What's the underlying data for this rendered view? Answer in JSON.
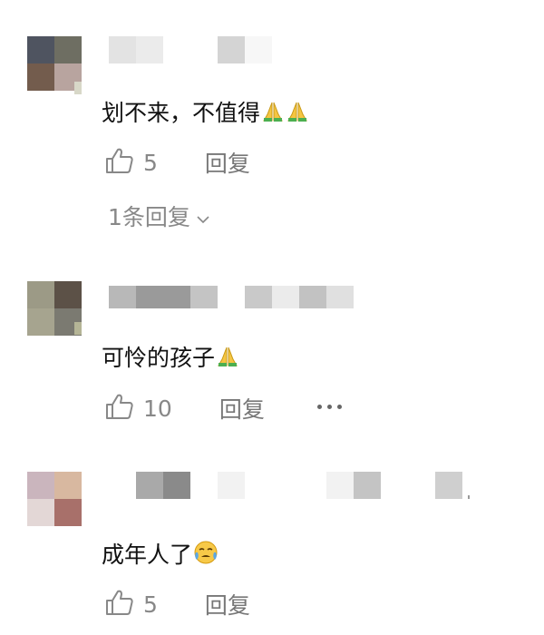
{
  "colors": {
    "text": "#111111",
    "muted": "#888888",
    "reply": "#777777"
  },
  "comments": [
    {
      "text": "划不来，不值得",
      "emoji": [
        "folded-hands",
        "folded-hands"
      ],
      "likes": "5",
      "reply_label": "回复",
      "sub_replies_label": "1条回复"
    },
    {
      "text": "可怜的孩子",
      "emoji": [
        "folded-hands"
      ],
      "likes": "10",
      "reply_label": "回复",
      "more_icon": "more-dots-icon"
    },
    {
      "text": "成年人了",
      "emoji": [
        "crying-face"
      ],
      "likes": "5",
      "reply_label": "回复"
    }
  ]
}
